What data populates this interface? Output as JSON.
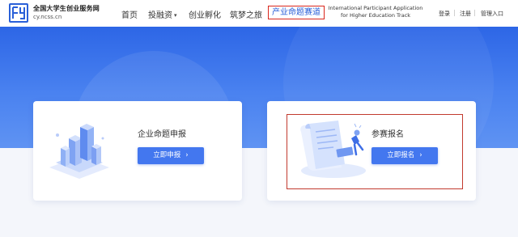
{
  "brand": {
    "name": "全国大学生创业服务网",
    "url": "cy.ncss.cn",
    "logo_icon": "cy-logo-icon"
  },
  "nav": {
    "items": [
      {
        "label": "首页"
      },
      {
        "label": "投融资"
      },
      {
        "label": "创业孵化"
      },
      {
        "label": "筑梦之旅"
      },
      {
        "label": "产业命题赛道"
      }
    ],
    "international": "International Participant Application for Higher Education Track"
  },
  "aux": {
    "login": "登录",
    "register": "注册",
    "admin": "管理入口",
    "separator": "|"
  },
  "cards": {
    "enterprise": {
      "title": "企业命题申报",
      "button": "立即申报",
      "icon": "isometric-buildings-icon"
    },
    "participate": {
      "title": "参赛报名",
      "button": "立即报名",
      "icon": "scroll-document-icon"
    }
  },
  "colors": {
    "brand_blue": "#2a60d8",
    "banner": "#3e78ec",
    "button": "#4377ef",
    "highlight_red": "#d9261c"
  }
}
